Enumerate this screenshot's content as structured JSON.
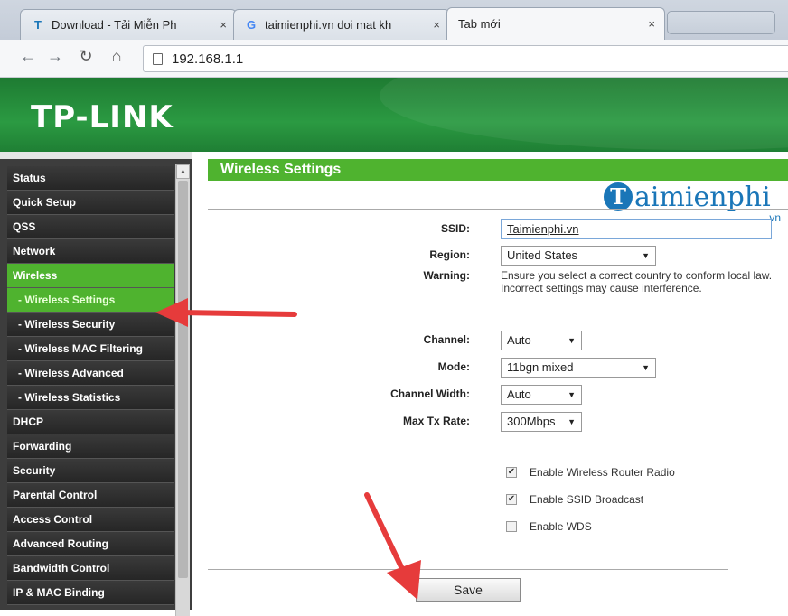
{
  "browser": {
    "tabs": [
      {
        "icon": "T",
        "title": "Download - Tải Miễn Ph",
        "close": "×"
      },
      {
        "icon": "G",
        "title": "taimienphi.vn doi mat kh",
        "close": "×"
      },
      {
        "icon": "",
        "title": "Tab mới",
        "close": "×"
      }
    ],
    "url": "192.168.1.1"
  },
  "brand": {
    "logo": "TP-LINK"
  },
  "sidebar": {
    "items": [
      {
        "label": "Status"
      },
      {
        "label": "Quick Setup"
      },
      {
        "label": "QSS"
      },
      {
        "label": "Network"
      },
      {
        "label": "Wireless"
      },
      {
        "label": "- Wireless Settings"
      },
      {
        "label": "- Wireless Security"
      },
      {
        "label": "- Wireless MAC Filtering"
      },
      {
        "label": "- Wireless Advanced"
      },
      {
        "label": "- Wireless Statistics"
      },
      {
        "label": "DHCP"
      },
      {
        "label": "Forwarding"
      },
      {
        "label": "Security"
      },
      {
        "label": "Parental Control"
      },
      {
        "label": "Access Control"
      },
      {
        "label": "Advanced Routing"
      },
      {
        "label": "Bandwidth Control"
      },
      {
        "label": "IP & MAC Binding"
      }
    ]
  },
  "main": {
    "title": "Wireless Settings",
    "watermark": {
      "letter": "T",
      "text": "aimienphi",
      "suffix": ".vn"
    },
    "ssid": {
      "label": "SSID:",
      "value": "Taimienphi.vn"
    },
    "region": {
      "label": "Region:",
      "value": "United States"
    },
    "warning": {
      "label": "Warning:",
      "text": "Ensure you select a correct country to conform local law. Incorrect settings may cause interference."
    },
    "channel": {
      "label": "Channel:",
      "value": "Auto"
    },
    "mode": {
      "label": "Mode:",
      "value": "11bgn mixed"
    },
    "channel_width": {
      "label": "Channel Width:",
      "value": "Auto"
    },
    "max_tx_rate": {
      "label": "Max Tx Rate:",
      "value": "300Mbps"
    },
    "checks": [
      {
        "label": "Enable Wireless Router Radio",
        "checked": true,
        "mark": "✔"
      },
      {
        "label": "Enable SSID Broadcast",
        "checked": true,
        "mark": "✔"
      },
      {
        "label": "Enable WDS",
        "checked": false,
        "mark": ""
      }
    ],
    "save_label": "Save"
  },
  "colors": {
    "brand_green": "#2b9a42",
    "menu_active": "#4fb32f",
    "arrow_red": "#e63b3b"
  }
}
